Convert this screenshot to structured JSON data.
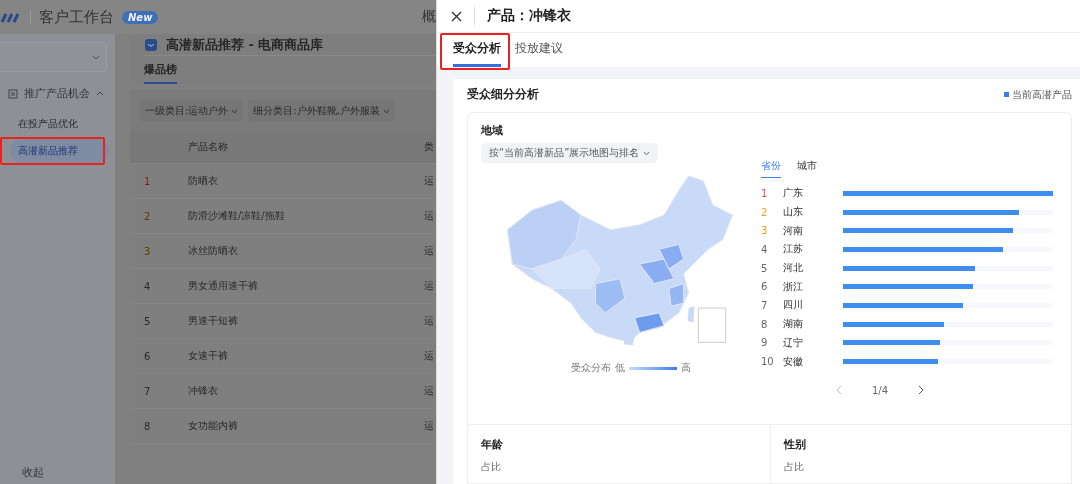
{
  "app": {
    "title": "客户工作台",
    "badge": "New",
    "nav_cut": "概"
  },
  "sidebar": {
    "group": {
      "label": "推广产品机会",
      "expanded": true
    },
    "items": [
      {
        "label": "在投产品优化",
        "selected": false
      },
      {
        "label": "高潜新品推荐",
        "selected": true
      }
    ],
    "collapse": "收起"
  },
  "page": {
    "title": "高潜新品推荐 - 电商商品库",
    "tabs": [
      {
        "label": "爆品榜",
        "selected": true
      }
    ],
    "filters": [
      "一级类目:运动户外",
      "细分类目:户外鞋靴,户外服装"
    ],
    "table": {
      "columns": [
        "产品名称",
        "类"
      ],
      "rows": [
        {
          "rank": "1",
          "name": "防晒衣",
          "column_3": "运"
        },
        {
          "rank": "2",
          "name": "防滑沙滩鞋/凉鞋/拖鞋",
          "column_3": "运"
        },
        {
          "rank": "3",
          "name": "冰丝防晒衣",
          "column_3": "运"
        },
        {
          "rank": "4",
          "name": "男女通用速干裤",
          "column_3": "运"
        },
        {
          "rank": "5",
          "name": "男速干短裤",
          "column_3": "运"
        },
        {
          "rank": "6",
          "name": "女速干裤",
          "column_3": "运"
        },
        {
          "rank": "7",
          "name": "冲锋衣",
          "column_3": "运"
        },
        {
          "rank": "8",
          "name": "女功能内裤",
          "column_3": "运"
        }
      ]
    }
  },
  "drawer": {
    "title": "产品：冲锋衣",
    "tabs": [
      {
        "label": "受众分析",
        "selected": true
      },
      {
        "label": "投放建议",
        "selected": false
      }
    ],
    "section": {
      "title": "受众细分分析",
      "legend": "当前高潜产品",
      "region": {
        "title": "地域",
        "dropdown": "按“当前高潜新品”展示地图与排名",
        "map_legend": {
          "label": "受众分布",
          "low": "低",
          "high": "高"
        },
        "tabs": [
          {
            "label": "省份",
            "selected": true
          },
          {
            "label": "城市",
            "selected": false
          }
        ],
        "ranking": [
          {
            "rank": "1",
            "name": "广东",
            "level": 1.0
          },
          {
            "rank": "2",
            "name": "山东",
            "level": 0.84
          },
          {
            "rank": "3",
            "name": "河南",
            "level": 0.81
          },
          {
            "rank": "4",
            "name": "江苏",
            "level": 0.76
          },
          {
            "rank": "5",
            "name": "河北",
            "level": 0.63
          },
          {
            "rank": "6",
            "name": "浙江",
            "level": 0.62
          },
          {
            "rank": "7",
            "name": "四川",
            "level": 0.57
          },
          {
            "rank": "8",
            "name": "湖南",
            "level": 0.48
          },
          {
            "rank": "9",
            "name": "辽宁",
            "level": 0.46
          },
          {
            "rank": "10",
            "name": "安徽",
            "level": 0.45
          }
        ],
        "pager": "1/4"
      },
      "panels": [
        {
          "title": "年龄",
          "subtitle": "占比"
        },
        {
          "title": "性别",
          "subtitle": "占比"
        }
      ]
    }
  }
}
